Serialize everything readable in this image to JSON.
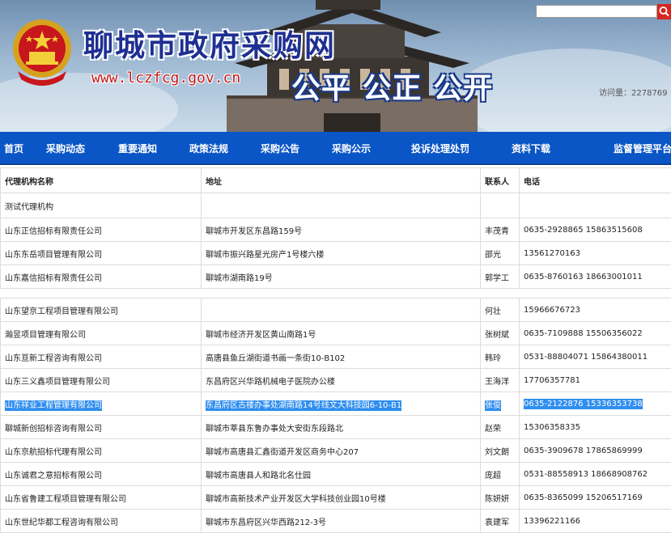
{
  "header": {
    "site_title": "聊城市政府采购网",
    "site_url": "www.lczfcg.gov.cn",
    "slogan": "公平 公正 公开",
    "visits": "访问量：2278769",
    "search_placeholder": ""
  },
  "nav": {
    "items": [
      "首页",
      "采购动态",
      "重要通知",
      "政策法规",
      "采购公告",
      "采购公示",
      "投诉处理处罚",
      "资料下载",
      "监督管理平台"
    ]
  },
  "table": {
    "headers": [
      "代理机构名称",
      "地址",
      "联系人",
      "电话"
    ],
    "rows_top": [
      {
        "name": "测试代理机构",
        "address": "",
        "contact": "",
        "phone": ""
      },
      {
        "name": "山东正信招标有限责任公司",
        "address": "聊城市开发区东昌路159号",
        "contact": "丰茂青",
        "phone": "0635-2928865 15863515608"
      },
      {
        "name": "山东东岳项目管理有限公司",
        "address": "聊城市振兴路星光房产1号楼六楼",
        "contact": "邵光",
        "phone": "13561270163"
      },
      {
        "name": "山东嘉信招标有限责任公司",
        "address": "聊城市湖南路19号",
        "contact": "郭学工",
        "phone": "0635-8760163 18663001011"
      }
    ],
    "rows_bottom": [
      {
        "name": "山东望京工程项目管理有限公司",
        "address": "",
        "contact": "何壮",
        "phone": "15966676723"
      },
      {
        "name": "瀚昱项目管理有限公司",
        "address": "聊城市经济开发区黄山南路1号",
        "contact": "张树斌",
        "phone": "0635-7109888 15506356022"
      },
      {
        "name": "山东亘新工程咨询有限公司",
        "address": "高唐县鱼丘湖街道书画一条街10-B102",
        "contact": "韩玲",
        "phone": "0531-88804071 15864380011"
      },
      {
        "name": "山东三义鑫项目管理有限公司",
        "address": "东昌府区兴华路机械电子医院办公楼",
        "contact": "王海洋",
        "phone": "17706357781"
      },
      {
        "name": "山东祥业工程管理有限公司",
        "address": "东昌府区古楼办事处湖南路14号线文大科技园6-10-B1",
        "contact": "张俊",
        "phone": "0635-2122876 15336353738",
        "highlighted": true
      },
      {
        "name": "聊城新创招标咨询有限公司",
        "address": "聊城市莘县东鲁办事处大安街东段路北",
        "contact": "赵荣",
        "phone": "15306358335"
      },
      {
        "name": "山东京航招标代理有限公司",
        "address": "聊城市高唐县汇鑫街道开发区商务中心207",
        "contact": "刘文朗",
        "phone": "0635-3909678 17865869999"
      },
      {
        "name": "山东诚君之意招标有限公司",
        "address": "聊城市高唐县人和路北名仕园",
        "contact": "庞超",
        "phone": "0531-88558913 18668908762"
      },
      {
        "name": "山东省鲁建工程项目管理有限公司",
        "address": "聊城市高新技术产业开发区大学科技创业园10号楼",
        "contact": "陈妍妍",
        "phone": "0635-8365099 15206517169"
      },
      {
        "name": "山东世纪华都工程咨询有限公司",
        "address": "聊城市东昌府区兴华西路212-3号",
        "contact": "袁建军",
        "phone": "13396221166"
      }
    ]
  },
  "colors": {
    "nav_bg": "#0b56c6",
    "title_blue": "#1e2f92",
    "url_red": "#c11a1a",
    "highlight": "#2f8eef"
  }
}
